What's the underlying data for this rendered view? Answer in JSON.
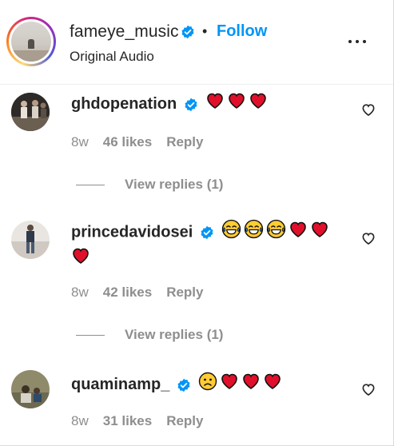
{
  "header": {
    "username": "fameye_music",
    "separator": "•",
    "follow_label": "Follow",
    "subtitle": "Original Audio"
  },
  "colors": {
    "accent": "#0095f6",
    "verified": "#0095f6",
    "heart": "#e0102b",
    "muted": "#8e8e8e"
  },
  "comments": [
    {
      "username": "ghdopenation",
      "verified": true,
      "emojis": [
        "red-heart",
        "red-heart",
        "red-heart"
      ],
      "time": "8w",
      "likes": "46 likes",
      "reply": "Reply",
      "view_replies": "View replies (1)"
    },
    {
      "username": "princedavidosei",
      "verified": true,
      "emojis": [
        "tears-of-joy",
        "tears-of-joy",
        "tears-of-joy",
        "red-heart",
        "red-heart",
        "red-heart"
      ],
      "time": "8w",
      "likes": "42 likes",
      "reply": "Reply",
      "view_replies": "View replies (1)"
    },
    {
      "username": "quaminamp_",
      "verified": true,
      "emojis": [
        "slightly-frowning-face",
        "red-heart",
        "red-heart",
        "red-heart"
      ],
      "time": "8w",
      "likes": "31 likes",
      "reply": "Reply"
    }
  ]
}
